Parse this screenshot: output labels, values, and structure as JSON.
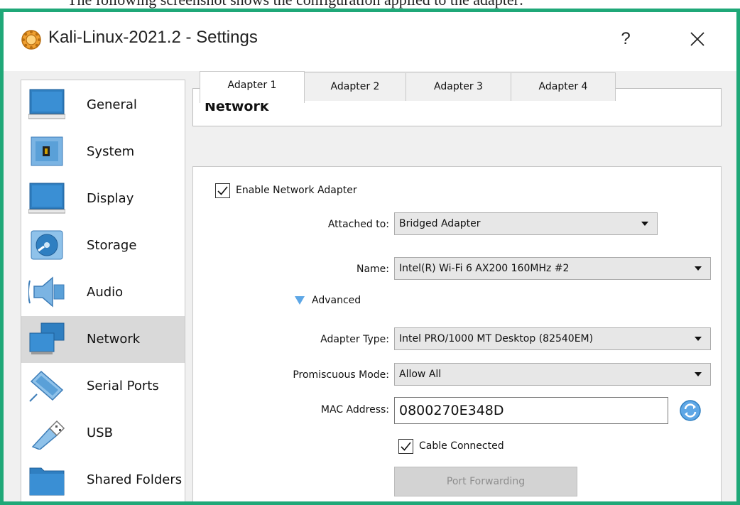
{
  "caption": "The following screenshot shows the configuration applied to the adapter:",
  "window": {
    "title": "Kali-Linux-2021.2 - Settings",
    "help_label": "?",
    "close_label": "close"
  },
  "sidebar": {
    "items": [
      {
        "label": "General",
        "icon": "monitor-icon",
        "active": false
      },
      {
        "label": "System",
        "icon": "chip-icon",
        "active": false
      },
      {
        "label": "Display",
        "icon": "display-icon",
        "active": false
      },
      {
        "label": "Storage",
        "icon": "disc-icon",
        "active": false
      },
      {
        "label": "Audio",
        "icon": "speaker-icon",
        "active": false
      },
      {
        "label": "Network",
        "icon": "network-icon",
        "active": true
      },
      {
        "label": "Serial Ports",
        "icon": "serial-cable-icon",
        "active": false
      },
      {
        "label": "USB",
        "icon": "usb-plug-icon",
        "active": false
      },
      {
        "label": "Shared Folders",
        "icon": "folder-icon",
        "active": false
      }
    ]
  },
  "section": {
    "title": "Network"
  },
  "tabs": [
    {
      "label": "Adapter 1",
      "active": true
    },
    {
      "label": "Adapter 2",
      "active": false
    },
    {
      "label": "Adapter 3",
      "active": false
    },
    {
      "label": "Adapter 4",
      "active": false
    }
  ],
  "form": {
    "enable_adapter": {
      "label": "Enable Network Adapter",
      "checked": true
    },
    "attached_to": {
      "label": "Attached to:",
      "value": "Bridged Adapter"
    },
    "name": {
      "label": "Name:",
      "value": "Intel(R) Wi-Fi 6 AX200 160MHz #2"
    },
    "advanced": {
      "label": "Advanced",
      "expanded": true
    },
    "adapter_type": {
      "label": "Adapter Type:",
      "value": "Intel PRO/1000 MT Desktop (82540EM)"
    },
    "promiscuous_mode": {
      "label": "Promiscuous Mode:",
      "value": "Allow All"
    },
    "mac_address": {
      "label": "MAC Address:",
      "value": "0800270E348D"
    },
    "cable_connected": {
      "label": "Cable Connected",
      "checked": true
    },
    "port_forwarding": {
      "label": "Port Forwarding",
      "enabled": false
    }
  },
  "colors": {
    "frame_accent": "#1fa878",
    "active_sidebar": "#d9d9d9",
    "icon_blue": "#2f7fc1"
  }
}
